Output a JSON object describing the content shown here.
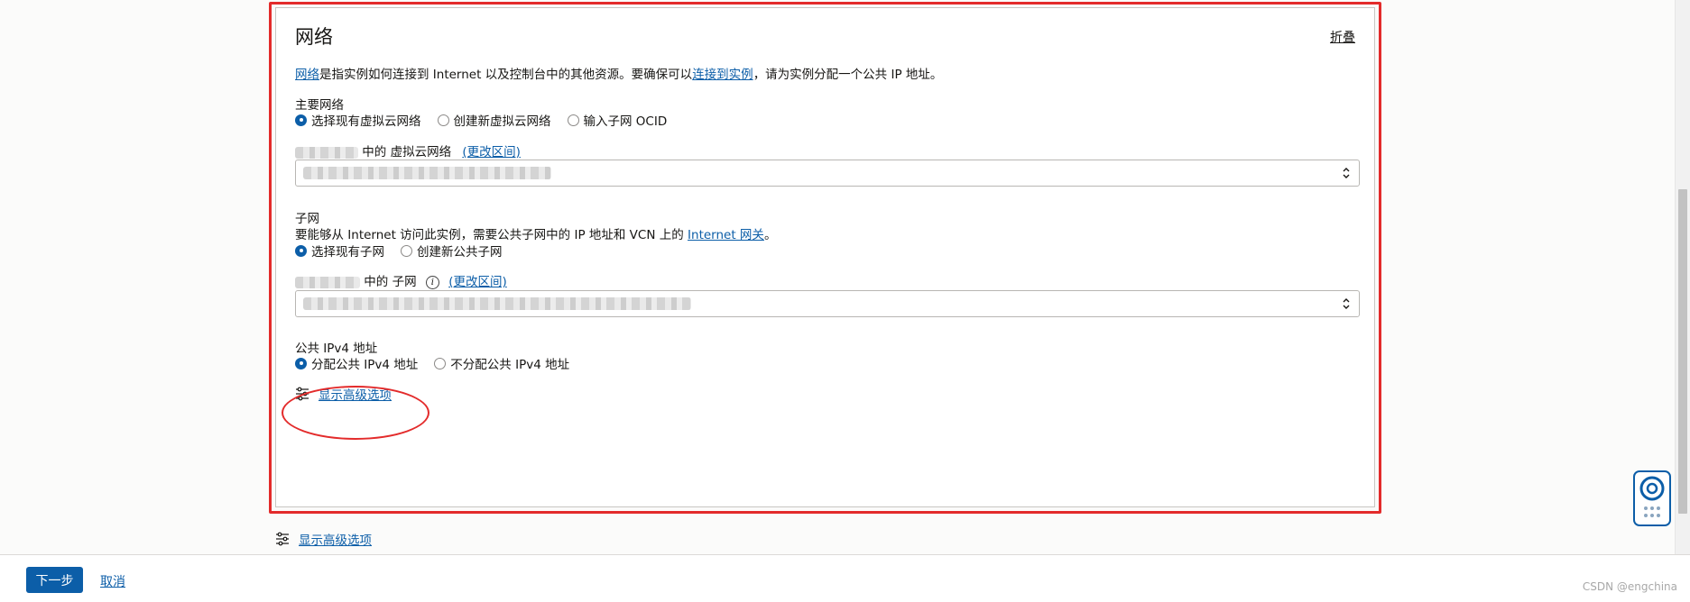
{
  "network": {
    "title": "网络",
    "collapse_label": "折叠",
    "desc": {
      "link1": "网络",
      "text1": "是指实例如何连接到 Internet 以及控制台中的其他资源。要确保可以",
      "link2": "连接到实例",
      "text2": "，请为实例分配一个公共 IP 地址。"
    },
    "primary_network": {
      "label": "主要网络",
      "options": [
        "选择现有虚拟云网络",
        "创建新虚拟云网络",
        "输入子网 OCID"
      ],
      "selected_index": 0
    },
    "vcn": {
      "label_middle": "中的 虚拟云网络",
      "change_link": "(更改区间)"
    },
    "subnet": {
      "label": "子网",
      "hint_text": "要能够从 Internet 访问此实例，需要公共子网中的 IP 地址和 VCN 上的",
      "hint_link": "Internet 网关",
      "hint_end": "。",
      "options": [
        "选择现有子网",
        "创建新公共子网"
      ],
      "selected_index": 0,
      "label_middle": "中的 子网",
      "change_link": "(更改区间)"
    },
    "public_ip": {
      "label": "公共 IPv4 地址",
      "options": [
        "分配公共 IPv4 地址",
        "不分配公共 IPv4 地址"
      ],
      "selected_index": 0
    },
    "advanced_inner": "显示高级选项"
  },
  "advanced_outer": "显示高级选项",
  "footer": {
    "next_label": "下一步",
    "cancel_label": "取消",
    "watermark": "CSDN @engchina"
  },
  "colors": {
    "accent": "#0c5ea8",
    "highlight": "#e32b2b"
  },
  "icons": {
    "select_arrow": "chevron-up-down-icon",
    "info": "info-icon",
    "advanced": "sliders-icon",
    "help": "lifebuoy-icon"
  }
}
